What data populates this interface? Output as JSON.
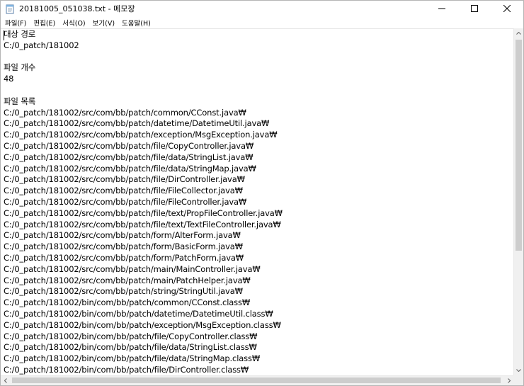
{
  "window": {
    "title": "20181005_051038.txt - 메모장"
  },
  "menu": [
    {
      "label": "파일(F)"
    },
    {
      "label": "편집(E)"
    },
    {
      "label": "서식(O)"
    },
    {
      "label": "보기(V)"
    },
    {
      "label": "도움말(H)"
    }
  ],
  "icons": {
    "app": "notepad-icon",
    "minimize": "minimize-icon",
    "maximize": "maximize-icon",
    "close": "close-icon",
    "scroll_up": "arrow-up-icon",
    "scroll_down": "arrow-down-icon",
    "scroll_left": "arrow-left-icon",
    "scroll_right": "arrow-right-icon"
  },
  "editor": {
    "lines": [
      "대상 경로",
      "C:/0_patch/181002",
      "",
      "파일 개수",
      "48",
      "",
      "파일 목록",
      "C:/0_patch/181002/src/com/bb/patch/common/CConst.java₩",
      "C:/0_patch/181002/src/com/bb/patch/datetime/DatetimeUtil.java₩",
      "C:/0_patch/181002/src/com/bb/patch/exception/MsgException.java₩",
      "C:/0_patch/181002/src/com/bb/patch/file/CopyController.java₩",
      "C:/0_patch/181002/src/com/bb/patch/file/data/StringList.java₩",
      "C:/0_patch/181002/src/com/bb/patch/file/data/StringMap.java₩",
      "C:/0_patch/181002/src/com/bb/patch/file/DirController.java₩",
      "C:/0_patch/181002/src/com/bb/patch/file/FileCollector.java₩",
      "C:/0_patch/181002/src/com/bb/patch/file/FileController.java₩",
      "C:/0_patch/181002/src/com/bb/patch/file/text/PropFileController.java₩",
      "C:/0_patch/181002/src/com/bb/patch/file/text/TextFileController.java₩",
      "C:/0_patch/181002/src/com/bb/patch/form/AlterForm.java₩",
      "C:/0_patch/181002/src/com/bb/patch/form/BasicForm.java₩",
      "C:/0_patch/181002/src/com/bb/patch/form/PatchForm.java₩",
      "C:/0_patch/181002/src/com/bb/patch/main/MainController.java₩",
      "C:/0_patch/181002/src/com/bb/patch/main/PatchHelper.java₩",
      "C:/0_patch/181002/src/com/bb/patch/string/StringUtil.java₩",
      "C:/0_patch/181002/bin/com/bb/patch/common/CConst.class₩",
      "C:/0_patch/181002/bin/com/bb/patch/datetime/DatetimeUtil.class₩",
      "C:/0_patch/181002/bin/com/bb/patch/exception/MsgException.class₩",
      "C:/0_patch/181002/bin/com/bb/patch/file/CopyController.class₩",
      "C:/0_patch/181002/bin/com/bb/patch/file/data/StringList.class₩",
      "C:/0_patch/181002/bin/com/bb/patch/file/data/StringMap.class₩",
      "C:/0_patch/181002/bin/com/bb/patch/file/DirController.class₩"
    ]
  }
}
